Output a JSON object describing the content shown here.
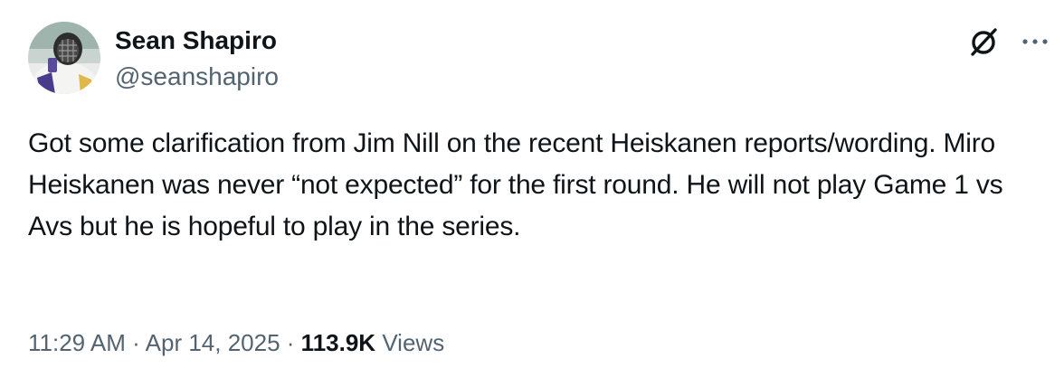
{
  "author": {
    "display_name": "Sean Shapiro",
    "handle": "@seanshapiro",
    "avatar": "goalie-mask-avatar"
  },
  "header_icons": {
    "grok": "grok-slash-icon",
    "more": "more-ellipsis-icon"
  },
  "tweet": {
    "text": "Got some clarification from Jim Nill on the recent Heiskanen reports/wording. Miro Heiskanen was never “not expected” for the first round. He will not play Game 1 vs Avs but he is hopeful to play in the series."
  },
  "meta": {
    "time": "11:29 AM",
    "separator": "·",
    "date": "Apr 14, 2025",
    "views_count": "113.9K",
    "views_label": "Views"
  },
  "colors": {
    "text_primary": "#0f1419",
    "text_secondary": "#536471",
    "background": "#ffffff"
  }
}
